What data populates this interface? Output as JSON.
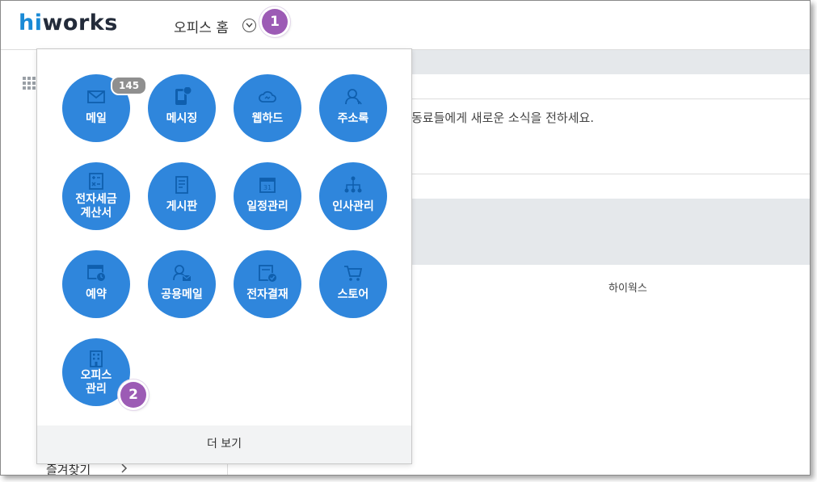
{
  "header": {
    "logo_h": "hi",
    "logo_rest": "works",
    "nav_label": "오피스 홈"
  },
  "markers": {
    "m1": "1",
    "m2": "2"
  },
  "background": {
    "news_prompt": "동료들에게 새로운 소식을 전하세요.",
    "company_name": "하이웍스",
    "favorites_label": "즐겨찾기"
  },
  "apps": [
    {
      "label": "메일",
      "icon": "mail-icon",
      "badge": "145"
    },
    {
      "label": "메시징",
      "icon": "phone-message-icon"
    },
    {
      "label": "웹하드",
      "icon": "cloud-icon"
    },
    {
      "label": "주소록",
      "icon": "contacts-icon"
    },
    {
      "label_line1": "전자세금",
      "label_line2": "계산서",
      "icon": "calculator-icon"
    },
    {
      "label": "게시판",
      "icon": "board-icon"
    },
    {
      "label": "일정관리",
      "icon": "calendar-icon",
      "calendar_day": "31"
    },
    {
      "label": "인사관리",
      "icon": "org-chart-icon"
    },
    {
      "label": "예약",
      "icon": "reservation-icon"
    },
    {
      "label": "공용메일",
      "icon": "shared-mail-icon"
    },
    {
      "label": "전자결재",
      "icon": "approval-icon"
    },
    {
      "label": "스토어",
      "icon": "cart-icon"
    },
    {
      "label_line1": "오피스",
      "label_line2": "관리",
      "icon": "building-icon"
    }
  ],
  "more_label": "더 보기",
  "colors": {
    "app_blue": "#2f86dc",
    "marker_purple": "#9c5bb5",
    "logo_blue": "#1a8ad6"
  }
}
